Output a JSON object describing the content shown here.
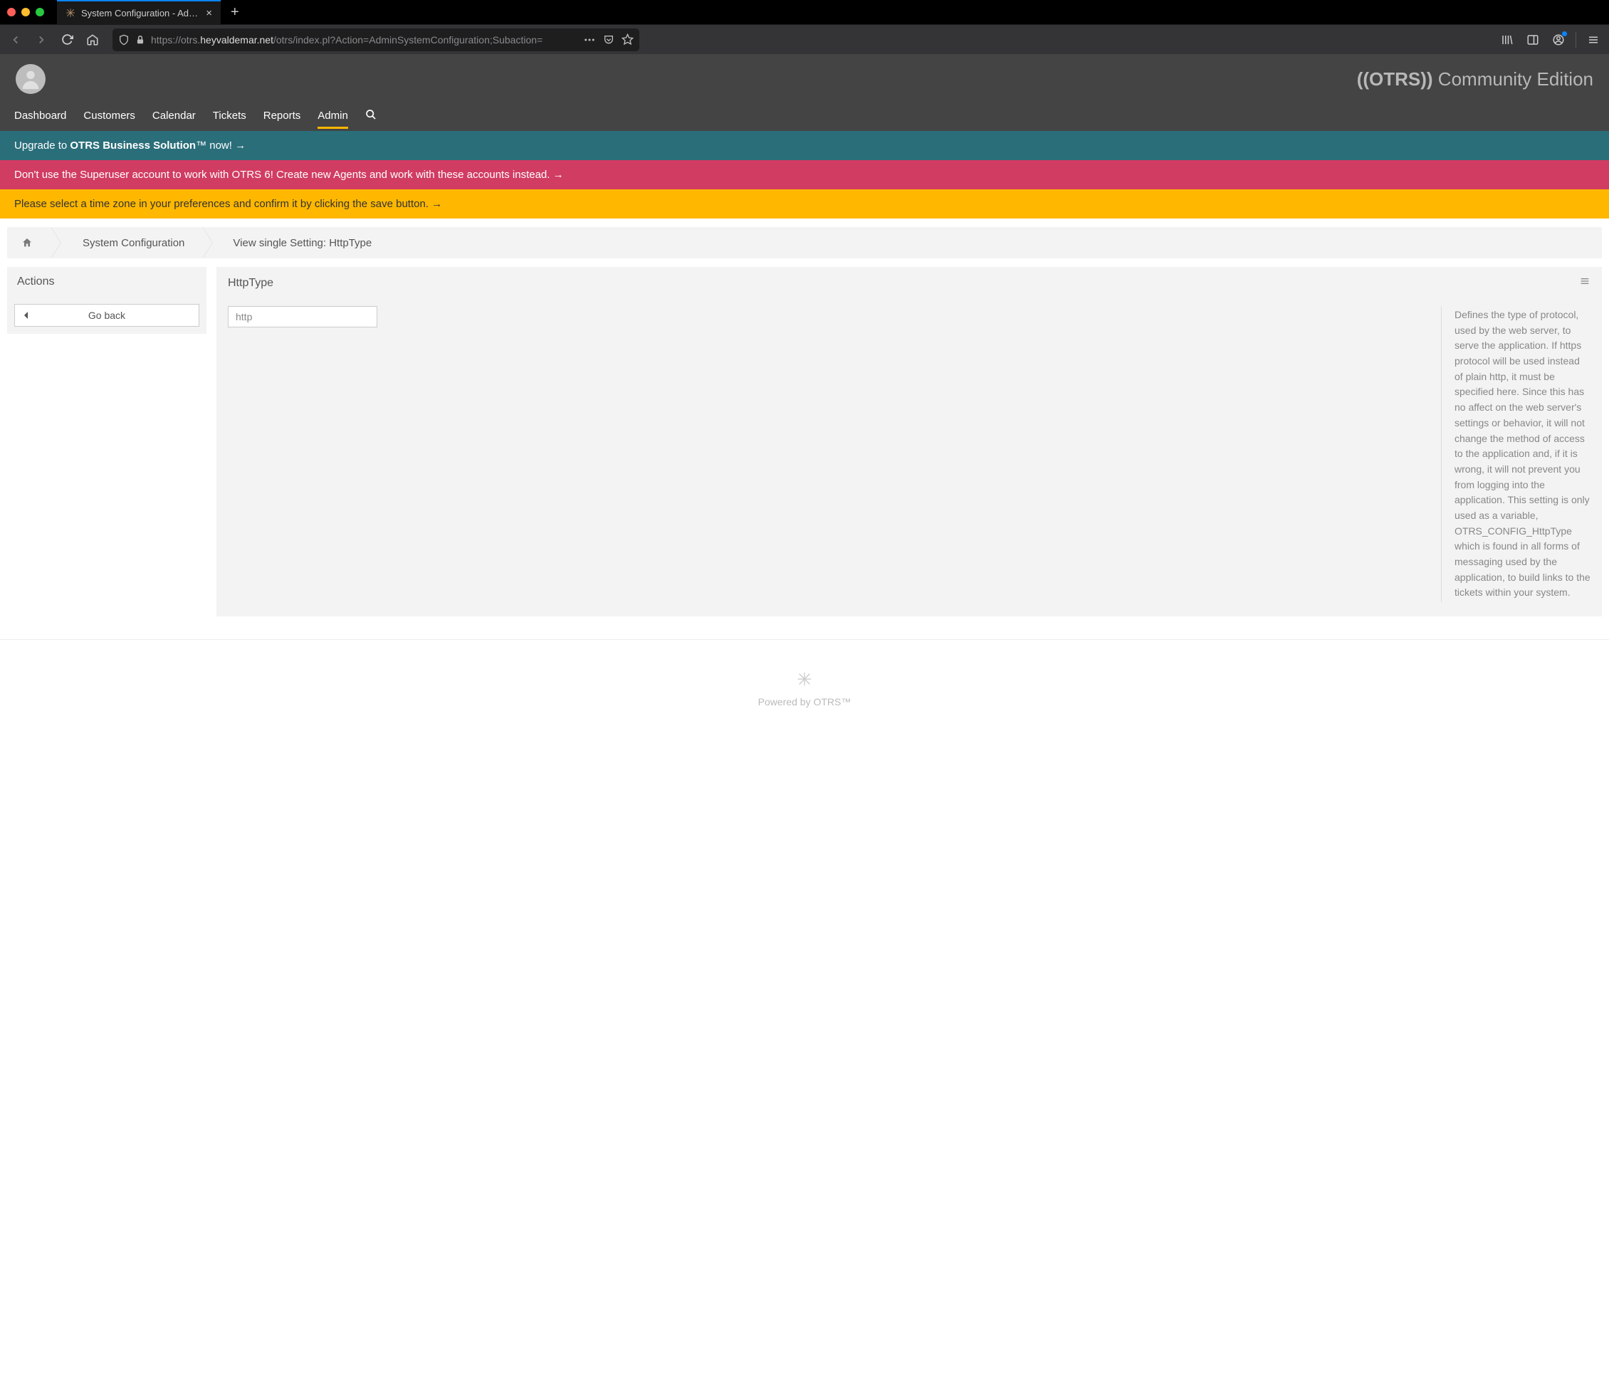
{
  "browser": {
    "tab_title": "System Configuration - Admin -",
    "url_prefix": "https://otrs.",
    "url_domain": "heyvaldemar.net",
    "url_path": "/otrs/index.pl?Action=AdminSystemConfiguration;Subaction="
  },
  "header": {
    "brand_strong": "((OTRS))",
    "brand_rest": " Community Edition",
    "nav": {
      "dashboard": "Dashboard",
      "customers": "Customers",
      "calendar": "Calendar",
      "tickets": "Tickets",
      "reports": "Reports",
      "admin": "Admin"
    }
  },
  "banners": {
    "upgrade_prefix": "Upgrade to ",
    "upgrade_bold": "OTRS Business Solution",
    "upgrade_suffix": "™ now! →",
    "superuser": "Don't use the Superuser account to work with OTRS 6! Create new Agents and work with these accounts instead. →",
    "timezone": "Please select a time zone in your preferences and confirm it by clicking the save button. →"
  },
  "breadcrumb": {
    "level1": "System Configuration",
    "level2": "View single Setting: HttpType"
  },
  "sidebar": {
    "title": "Actions",
    "go_back": "Go back"
  },
  "content": {
    "title": "HttpType",
    "value": "http",
    "description": "Defines the type of protocol, used by the web server, to serve the application. If https protocol will be used instead of plain http, it must be specified here. Since this has no affect on the web server's settings or behavior, it will not change the method of access to the application and, if it is wrong, it will not prevent you from logging into the application. This setting is only used as a variable, OTRS_CONFIG_HttpType which is found in all forms of messaging used by the application, to build links to the tickets within your system."
  },
  "footer": {
    "powered": "Powered by OTRS™"
  }
}
